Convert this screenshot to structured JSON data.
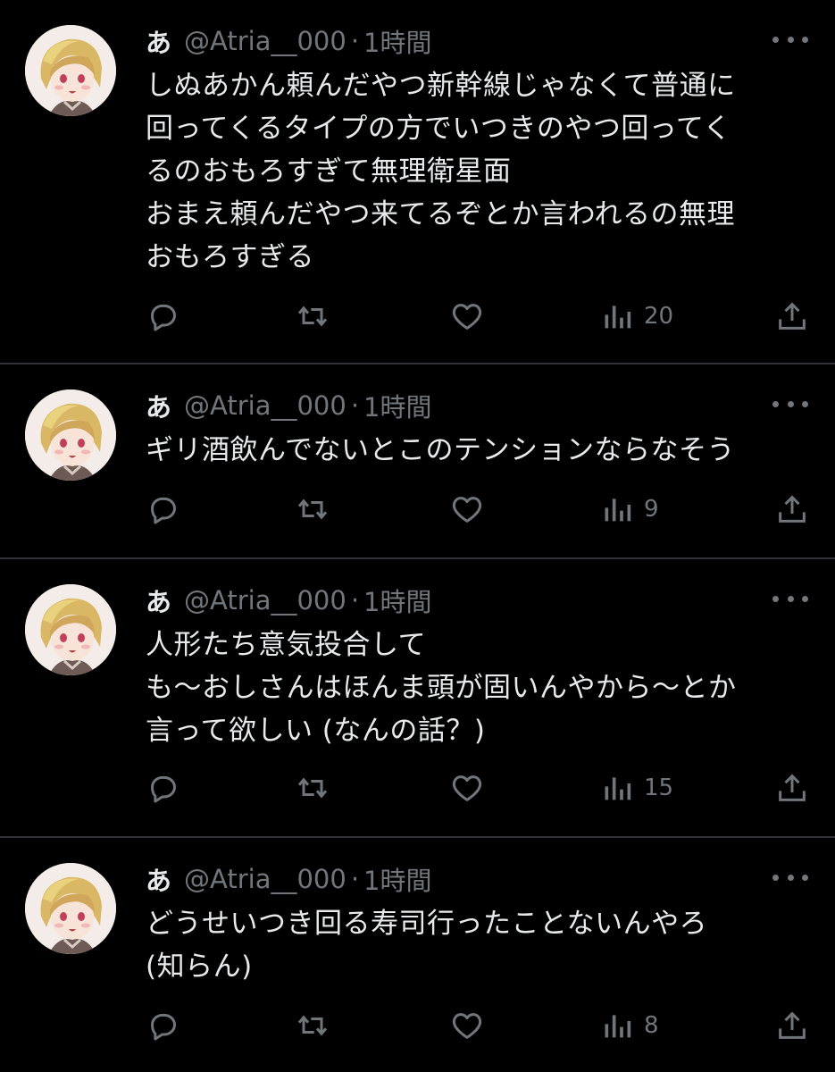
{
  "colors": {
    "background": "#000000",
    "text_primary": "#e7e9ea",
    "text_secondary": "#71767b",
    "divider": "#2f3336"
  },
  "icons": {
    "reply": "speech-bubble",
    "retweet": "two-arrows-loop",
    "like": "heart-outline",
    "views": "bar-chart",
    "share": "upload-arrow",
    "more": "three-dots"
  },
  "tweets": [
    {
      "display_name": "あ",
      "handle": "@Atria__000",
      "separator": "·",
      "time": "1時間",
      "text": "しぬあかん頼んだやつ新幹線じゃなくて普通に\n回ってくるタイプの方でいつきのやつ回ってく\nるのおもろすぎて無理衛星面\nおまえ頼んだやつ来てるぞとか言われるの無理\nおもろすぎる",
      "views": "20"
    },
    {
      "display_name": "あ",
      "handle": "@Atria__000",
      "separator": "·",
      "time": "1時間",
      "text": "ギリ酒飲んでないとこのテンションならなそう",
      "views": "9"
    },
    {
      "display_name": "あ",
      "handle": "@Atria__000",
      "separator": "·",
      "time": "1時間",
      "text": "人形たち意気投合して\nも〜おしさんはほんま頭が固いんやから〜とか\n言って欲しい (なんの話？)",
      "views": "15"
    },
    {
      "display_name": "あ",
      "handle": "@Atria__000",
      "separator": "·",
      "time": "1時間",
      "text": "どうせいつき回る寿司行ったことないんやろ\n(知らん)",
      "views": "8"
    }
  ]
}
